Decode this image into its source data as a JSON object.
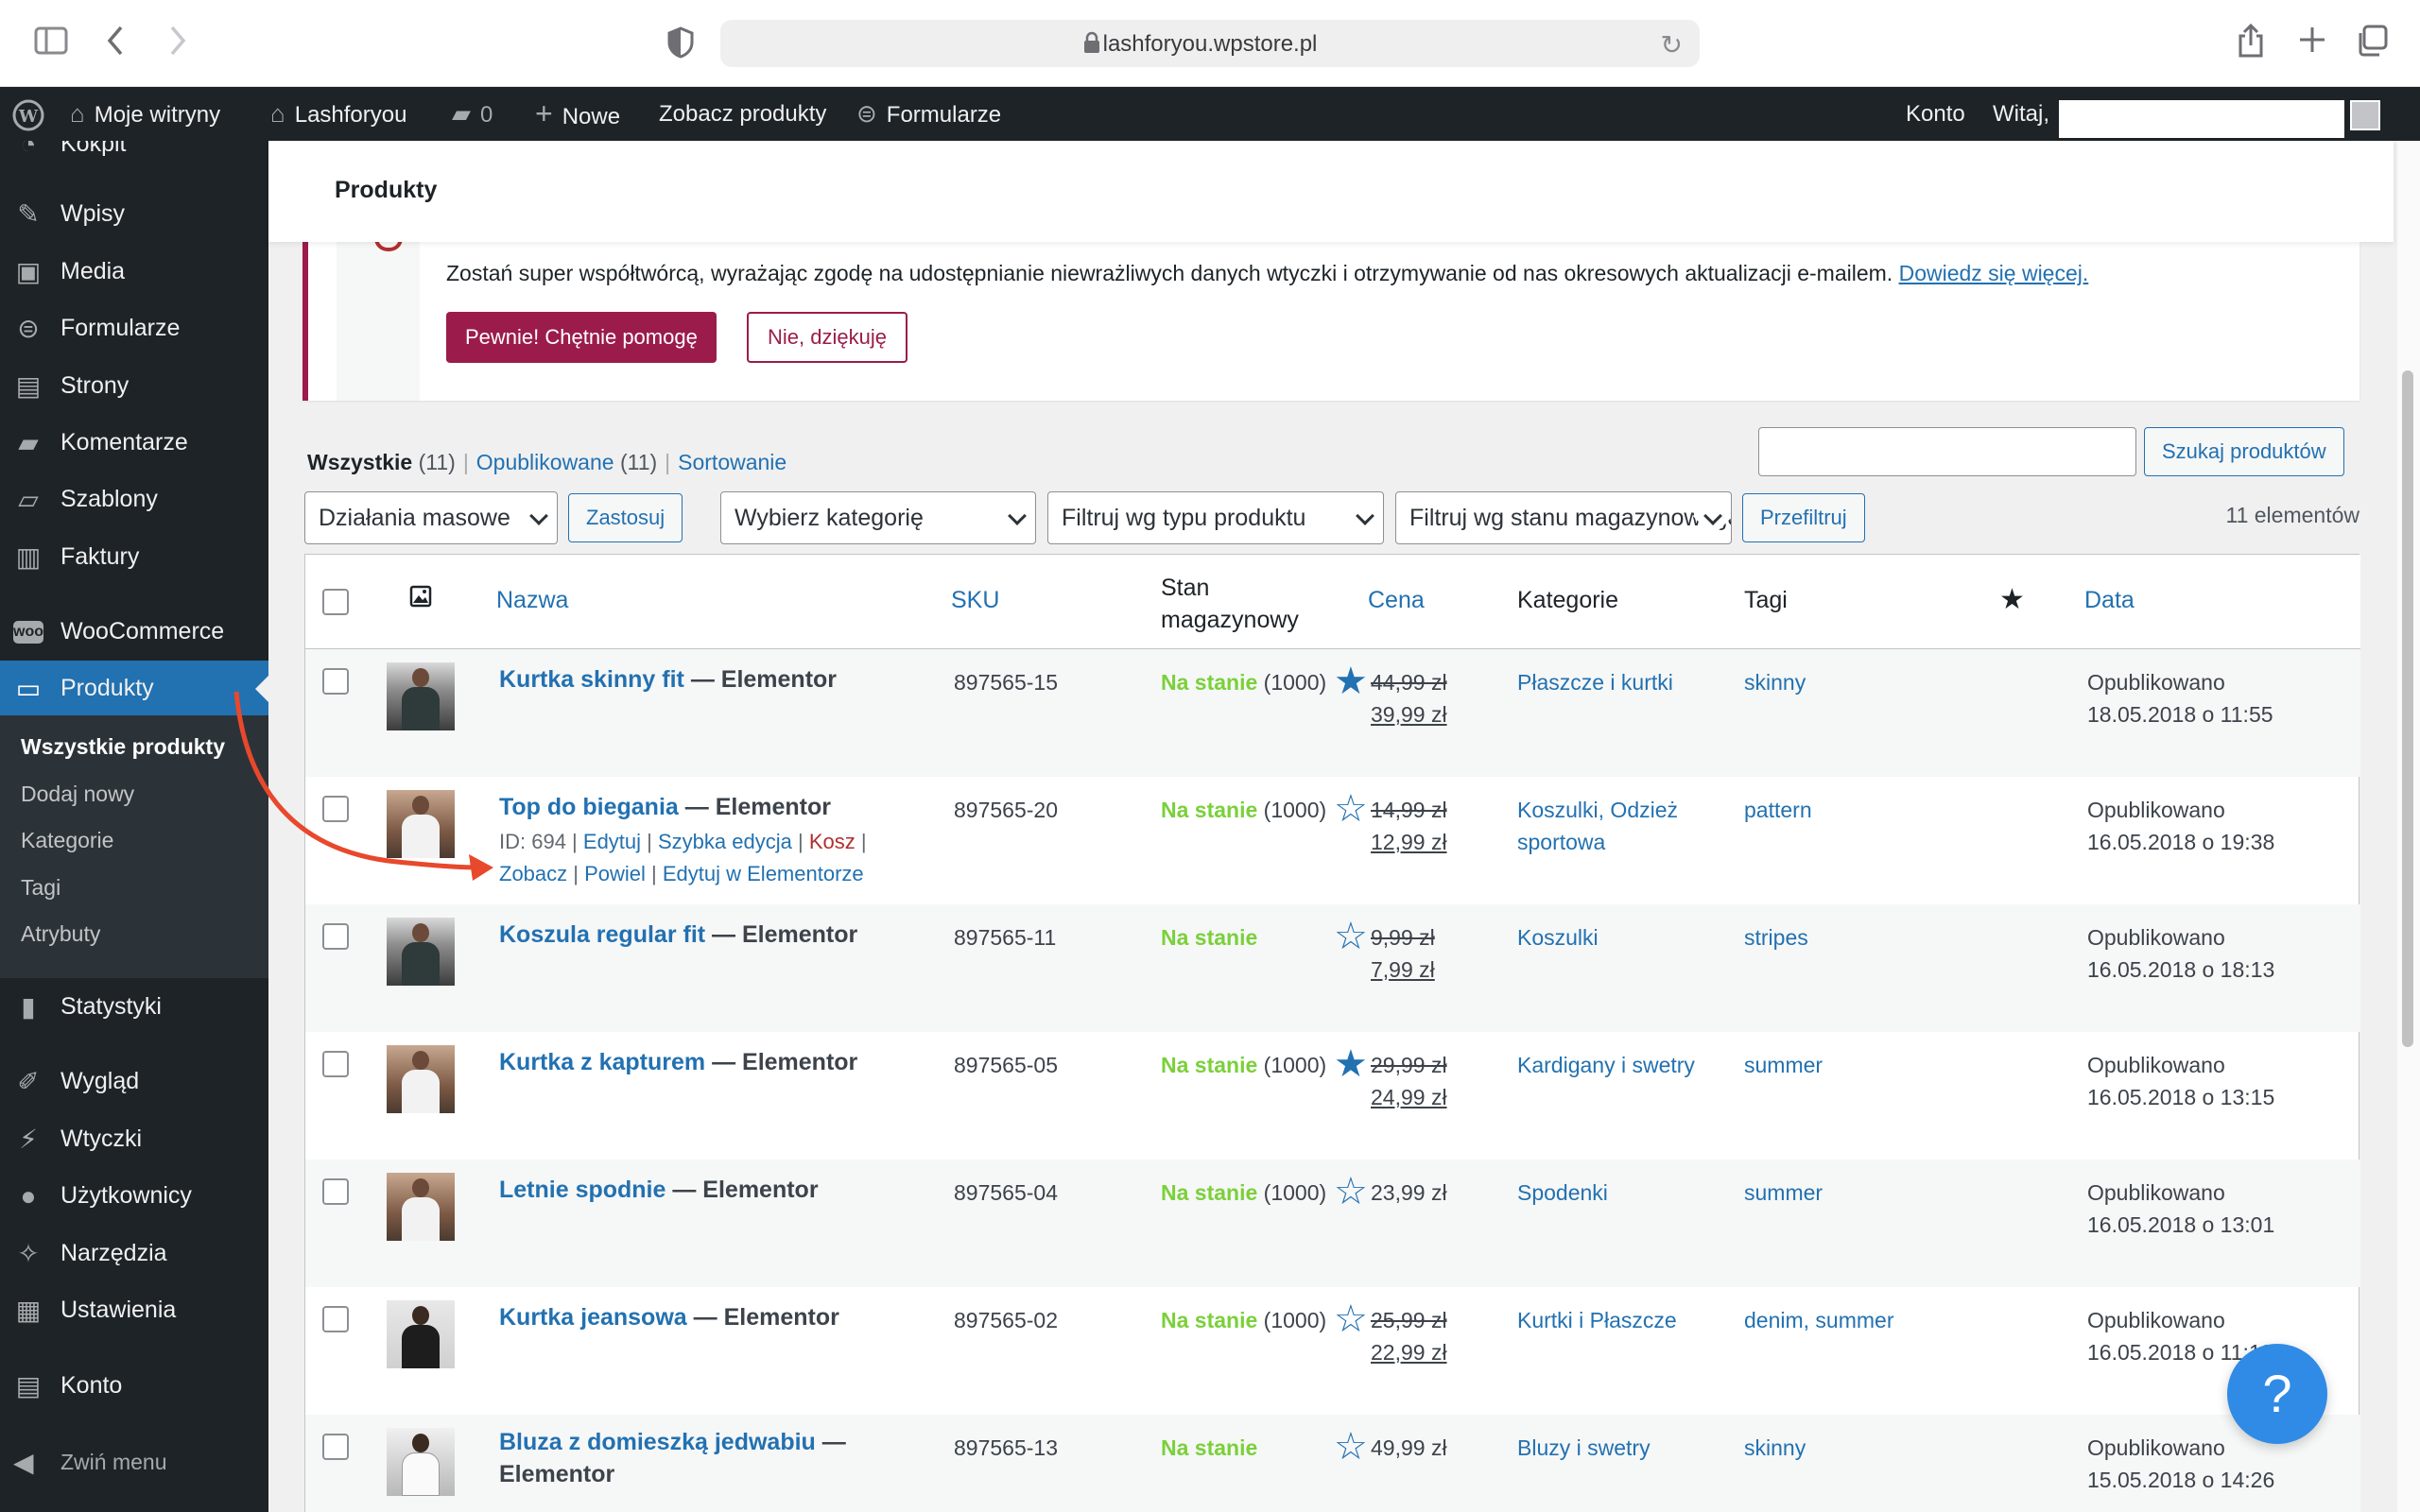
{
  "browser": {
    "url": "lashforyou.wpstore.pl"
  },
  "admin_bar": {
    "my_sites": "Moje witryny",
    "site_name": "Lashforyou",
    "comments_count": "0",
    "new": "Nowe",
    "view_products": "Zobacz produkty",
    "forms": "Formularze",
    "account": "Konto",
    "greeting": "Witaj,"
  },
  "sidebar": {
    "partial_top": "Kokpit",
    "items": [
      {
        "label": "Wpisy",
        "icon": "pin-icon"
      },
      {
        "label": "Media",
        "icon": "media-icon"
      },
      {
        "label": "Formularze",
        "icon": "forms-icon"
      },
      {
        "label": "Strony",
        "icon": "pages-icon"
      },
      {
        "label": "Komentarze",
        "icon": "comments-icon"
      },
      {
        "label": "Szablony",
        "icon": "folder-icon"
      },
      {
        "label": "Faktury",
        "icon": "invoice-icon"
      },
      {
        "label": "WooCommerce",
        "icon": "woo-icon"
      },
      {
        "label": "Produkty",
        "icon": "products-icon"
      },
      {
        "label": "Statystyki",
        "icon": "chart-icon"
      },
      {
        "label": "Wygląd",
        "icon": "brush-icon"
      },
      {
        "label": "Wtyczki",
        "icon": "plugin-icon"
      },
      {
        "label": "Użytkownicy",
        "icon": "user-icon"
      },
      {
        "label": "Narzędzia",
        "icon": "wrench-icon"
      },
      {
        "label": "Ustawienia",
        "icon": "settings-icon"
      },
      {
        "label": "Konto",
        "icon": "account-icon"
      }
    ],
    "submenu": [
      "Wszystkie produkty",
      "Dodaj nowy",
      "Kategorie",
      "Tagi",
      "Atrybuty"
    ],
    "collapse": "Zwiń menu"
  },
  "header": {
    "title": "Produkty"
  },
  "notice": {
    "text": "Zostań super współtwórcą, wyrażając zgodę na udostępnianie niewrażliwych danych wtyczki i otrzymywanie od nas okresowych aktualizacji e-mailem.",
    "link": "Dowiedz się więcej.",
    "accept": "Pewnie! Chętnie pomogę",
    "decline": "Nie, dziękuję"
  },
  "views": {
    "all_label": "Wszystkie",
    "all_count": "(11)",
    "published_label": "Opublikowane",
    "published_count": "(11)",
    "sorting": "Sortowanie"
  },
  "toolbar": {
    "search_button": "Szukaj produktów",
    "bulk_actions": "Działania masowe",
    "apply": "Zastosuj",
    "category": "Wybierz kategorię",
    "product_type": "Filtruj wg typu produktu",
    "stock_status": "Filtruj wg stanu magazynowego",
    "filter": "Przefiltruj",
    "items_count": "11 elementów"
  },
  "table": {
    "headers": {
      "name": "Nazwa",
      "sku": "SKU",
      "stock_line1": "Stan",
      "stock_line2": "magazynowy",
      "price": "Cena",
      "categories": "Kategorie",
      "tags": "Tagi",
      "date": "Data"
    },
    "rows": [
      {
        "name": "Kurtka skinny fit",
        "suffix": "— Elementor",
        "sku": "897565-15",
        "stock": "Na stanie",
        "qty": "(1000)",
        "price_old": "44,99 zł",
        "price_new": "39,99 zł",
        "categories": "Płaszcze i kurtki",
        "tags": "skinny",
        "featured": true,
        "status": "Opublikowano",
        "date": "18.05.2018 o 11:55"
      },
      {
        "name": "Top do biegania",
        "suffix": "— Elementor",
        "sku": "897565-20",
        "stock": "Na stanie",
        "qty": "(1000)",
        "price_old": "14,99 zł",
        "price_new": "12,99 zł",
        "categories_line1": "Koszulki, Odzież",
        "categories_line2": "sportowa",
        "tags": "pattern",
        "featured": false,
        "status": "Opublikowano",
        "date": "16.05.2018 o 19:38",
        "actions": {
          "id": "ID: 694",
          "edit": "Edytuj",
          "quick_edit": "Szybka edycja",
          "trash": "Kosz",
          "view": "Zobacz",
          "duplicate": "Powiel",
          "elementor": "Edytuj w Elementorze"
        }
      },
      {
        "name": "Koszula regular fit",
        "suffix": "— Elementor",
        "sku": "897565-11",
        "stock": "Na stanie",
        "qty": "",
        "price_old": "9,99 zł",
        "price_new": "7,99 zł",
        "categories": "Koszulki",
        "tags": "stripes",
        "featured": false,
        "status": "Opublikowano",
        "date": "16.05.2018 o 18:13"
      },
      {
        "name": "Kurtka z kapturem",
        "suffix": "— Elementor",
        "sku": "897565-05",
        "stock": "Na stanie",
        "qty": "(1000)",
        "price_old": "29,99 zł",
        "price_new": "24,99 zł",
        "categories": "Kardigany i swetry",
        "tags": "summer",
        "featured": true,
        "status": "Opublikowano",
        "date": "16.05.2018 o 13:15"
      },
      {
        "name": "Letnie spodnie",
        "suffix": "— Elementor",
        "sku": "897565-04",
        "stock": "Na stanie",
        "qty": "(1000)",
        "price": "23,99 zł",
        "categories": "Spodenki",
        "tags": "summer",
        "featured": false,
        "status": "Opublikowano",
        "date": "16.05.2018 o 13:01"
      },
      {
        "name": "Kurtka jeansowa",
        "suffix": "— Elementor",
        "sku": "897565-02",
        "stock": "Na stanie",
        "qty": "(1000)",
        "price_old": "25,99 zł",
        "price_new": "22,99 zł",
        "categories": "Kurtki i Płaszcze",
        "tags": "denim, summer",
        "featured": false,
        "status": "Opublikowano",
        "date": "16.05.2018 o 11:19"
      },
      {
        "name": "Bluza z domieszką jedwabiu",
        "suffix": "—",
        "suffix_line2": "Elementor",
        "sku": "897565-13",
        "stock": "Na stanie",
        "qty": "",
        "price": "49,99 zł",
        "categories": "Bluzy i swetry",
        "tags": "skinny",
        "featured": false,
        "status": "Opublikowano",
        "date": "15.05.2018 o 14:26"
      }
    ]
  },
  "help_button": "?",
  "colors": {
    "wp_dark": "#1d2327",
    "wp_blue": "#2271b1",
    "notice_accent": "#9b1c4a",
    "in_stock": "#7ad03a",
    "arrow": "#e8482c"
  }
}
